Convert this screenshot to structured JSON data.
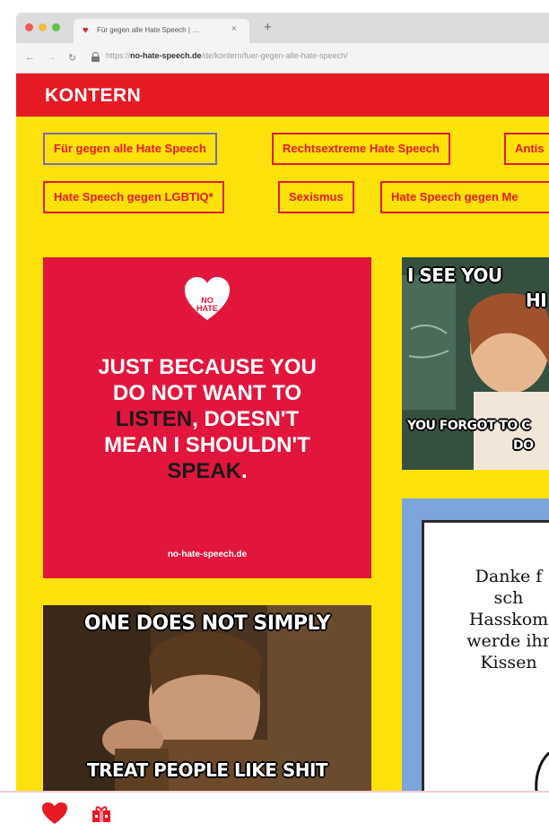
{
  "browser": {
    "tab_title": "Für gegen alle Hate Speech | …",
    "tab_close": "×",
    "new_tab": "+",
    "url_prefix": "https://",
    "url_host": "no-hate-speech.de",
    "url_path": "/de/kontern/fuer-gegen-alle-hate-speech/",
    "icons": {
      "back": "arrow-left-icon",
      "forward": "arrow-right-icon",
      "reload": "reload-icon",
      "lock": "lock-icon"
    }
  },
  "site": {
    "logo": "KONTERN"
  },
  "categories": [
    {
      "label": "Für gegen alle Hate Speech",
      "active": true
    },
    {
      "label": "Rechtsextreme Hate Speech",
      "active": false
    },
    {
      "label": "Antis",
      "active": false
    },
    {
      "label": "Hate Speech gegen LGBTIQ*",
      "active": false
    },
    {
      "label": "Sexismus",
      "active": false
    },
    {
      "label": "Hate Speech gegen Me",
      "active": false
    }
  ],
  "cards": {
    "red": {
      "badge_line1": "NO",
      "badge_line2": "HATE",
      "quote_1": "JUST BECAUSE YOU",
      "quote_2": "DO NOT WANT TO",
      "quote_3_dark": "LISTEN",
      "quote_3_rest": ", DOESN'T",
      "quote_4": "MEAN I SHOULDN'T",
      "quote_5_dark": "SPEAK",
      "quote_5_rest": ".",
      "credit": "no-hate-speech.de"
    },
    "boromir": {
      "top": "ONE DOES NOT SIMPLY",
      "bottom": "TREAT PEOPLE LIKE SHIT"
    },
    "teacher": {
      "top": "I SEE YOU",
      "top2": "HI",
      "bottom": "YOU FORGOT TO C",
      "bottom2": "DO"
    },
    "blue": {
      "line1": "Danke f",
      "line2": "sch",
      "line3": "Hasskom",
      "line4": "werde ihr",
      "line5": "Kissen"
    }
  },
  "colors": {
    "brand_red": "#e51a24",
    "brand_yellow": "#fce20a",
    "card_red": "#e2153c",
    "active_chip": "#7b6ab0"
  },
  "bottom_bar": {
    "icons": [
      "heart-icon",
      "gift-icon"
    ]
  }
}
